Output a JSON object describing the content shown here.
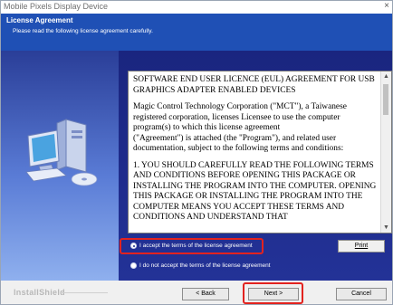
{
  "window": {
    "title": "Mobile Pixels Display Device",
    "close_glyph": "×"
  },
  "header": {
    "title": "License Agreement",
    "subtitle": "Please read the following license agreement carefully."
  },
  "license": {
    "paragraphs": [
      "SOFTWARE END USER LICENCE (EUL) AGREEMENT FOR USB GRAPHICS ADAPTER ENABLED DEVICES",
      "Magic Control Technology Corporation (\"MCT\"), a Taiwanese registered corporation, licenses Licensee to use the computer program(s) to which this license agreement",
      "(\"Agreement\") is attached (the \"Program\"), and related user documentation, subject to the following terms and conditions:",
      "1. YOU SHOULD CAREFULLY READ THE FOLLOWING TERMS AND CONDITIONS BEFORE OPENING THIS PACKAGE OR INSTALLING THE PROGRAM INTO THE COMPUTER. OPENING THIS PACKAGE OR INSTALLING THE PROGRAM INTO THE COMPUTER MEANS YOU ACCEPT THESE TERMS AND CONDITIONS AND UNDERSTAND THAT"
    ],
    "scroll_up": "▲",
    "scroll_down": "▼"
  },
  "options": {
    "accept_label": "I accept the terms of the license agreement",
    "decline_label": "I do not accept the terms of the license agreement",
    "selected": "accept"
  },
  "buttons": {
    "print": "Print",
    "back": "< Back",
    "next": "Next >",
    "cancel": "Cancel"
  },
  "footer": {
    "brand": "InstallShield"
  },
  "colors": {
    "header_blue": "#1f50b5",
    "panel_navy": "#1c2a86",
    "highlight_red": "#e2231f"
  }
}
